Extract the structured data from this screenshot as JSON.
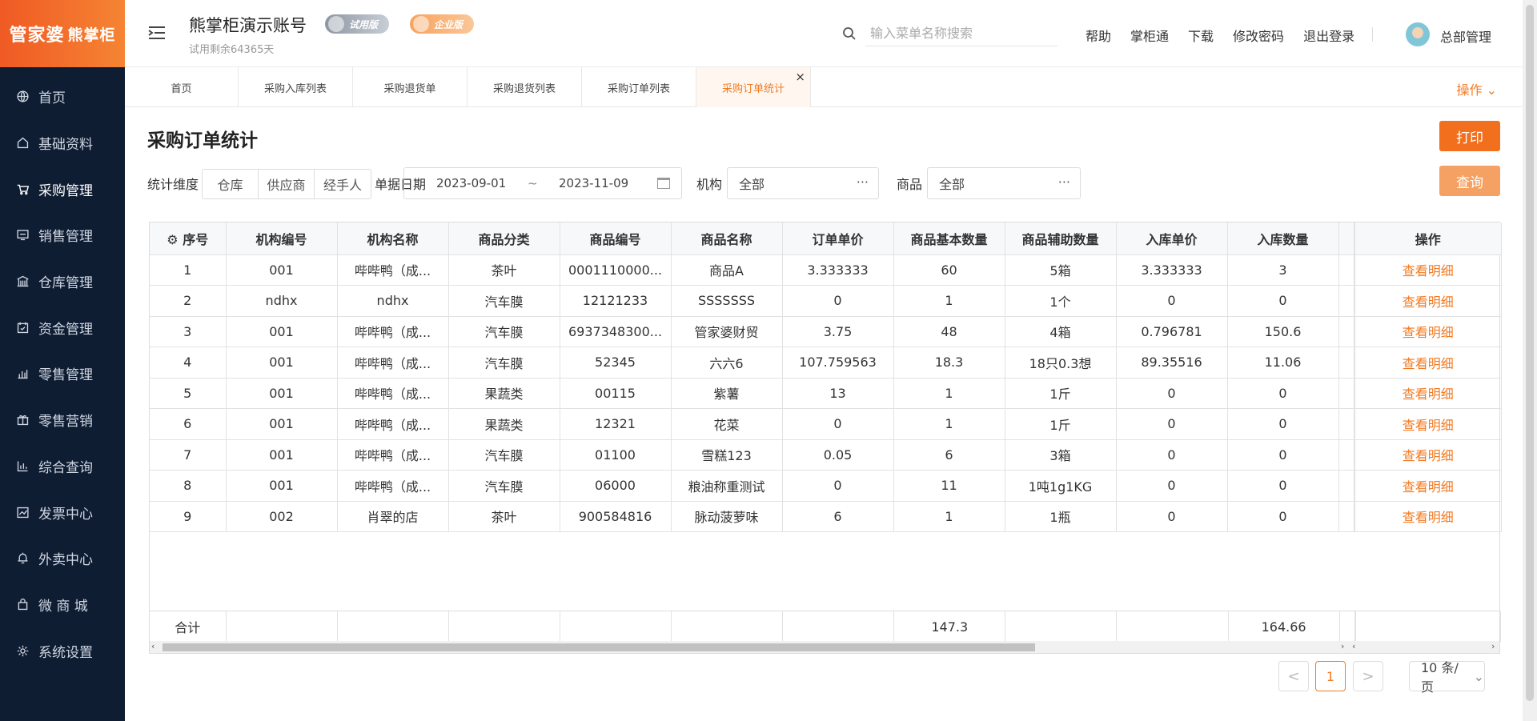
{
  "brand": {
    "logo_text": "管家婆",
    "logo_sub": "熊掌柜"
  },
  "sidebar": {
    "items": [
      {
        "label": "首页",
        "icon": "globe-icon"
      },
      {
        "label": "基础资料",
        "icon": "home-icon"
      },
      {
        "label": "采购管理",
        "icon": "cart-icon"
      },
      {
        "label": "销售管理",
        "icon": "monitor-icon"
      },
      {
        "label": "仓库管理",
        "icon": "warehouse-icon"
      },
      {
        "label": "资金管理",
        "icon": "calendar-icon"
      },
      {
        "label": "零售管理",
        "icon": "bar-chart-icon"
      },
      {
        "label": "零售营销",
        "icon": "gift-icon"
      },
      {
        "label": "综合查询",
        "icon": "column-chart-icon"
      },
      {
        "label": "发票中心",
        "icon": "line-chart-icon"
      },
      {
        "label": "外卖中心",
        "icon": "bell-icon"
      },
      {
        "label": "微 商 城",
        "icon": "bag-icon"
      },
      {
        "label": "系统设置",
        "icon": "gear-icon"
      }
    ]
  },
  "header": {
    "account_title": "熊掌柜演示账号",
    "trial_remaining": "试用剩余64365天",
    "badge_trial": "试用版",
    "badge_enterprise": "企业版",
    "search_placeholder": "输入菜单名称搜索",
    "links": [
      "帮助",
      "掌柜通",
      "下载",
      "修改密码",
      "退出登录"
    ],
    "user": "总部管理"
  },
  "tabs": {
    "items": [
      "首页",
      "采购入库列表",
      "采购退货单",
      "采购退货列表",
      "采购订单列表",
      "采购订单统计"
    ],
    "active": "采购订单统计",
    "close": "×",
    "ops_label": "操作"
  },
  "page": {
    "title": "采购订单统计",
    "print_label": "打印",
    "query_label": "查询"
  },
  "filters": {
    "dimension_label": "统计维度",
    "dimension_options": [
      "仓库",
      "供应商",
      "经手人"
    ],
    "date_label": "单据日期",
    "date_from": "2023-09-01",
    "date_sep": "~",
    "date_to": "2023-11-09",
    "org_label": "机构",
    "org_value": "全部",
    "goods_label": "商品",
    "goods_value": "全部",
    "more": "···"
  },
  "table": {
    "columns": [
      "序号",
      "机构编号",
      "机构名称",
      "商品分类",
      "商品编号",
      "商品名称",
      "订单单价",
      "商品基本数量",
      "商品辅助数量",
      "入库单价",
      "入库数量",
      "操作"
    ],
    "action_label": "查看明细",
    "rows": [
      [
        "1",
        "001",
        "哔哔鸭（成...",
        "茶叶",
        "0001110000...",
        "商品A",
        "3.333333",
        "60",
        "5箱",
        "3.333333",
        "3"
      ],
      [
        "2",
        "ndhx",
        "ndhx",
        "汽车膜",
        "12121233",
        "SSSSSSS",
        "0",
        "1",
        "1个",
        "0",
        "0"
      ],
      [
        "3",
        "001",
        "哔哔鸭（成...",
        "汽车膜",
        "6937348300...",
        "管家婆财贸",
        "3.75",
        "48",
        "4箱",
        "0.796781",
        "150.6"
      ],
      [
        "4",
        "001",
        "哔哔鸭（成...",
        "汽车膜",
        "52345",
        "六六6",
        "107.759563",
        "18.3",
        "18只0.3想",
        "89.35516",
        "11.06"
      ],
      [
        "5",
        "001",
        "哔哔鸭（成...",
        "果蔬类",
        "00115",
        "紫薯",
        "13",
        "1",
        "1斤",
        "0",
        "0"
      ],
      [
        "6",
        "001",
        "哔哔鸭（成...",
        "果蔬类",
        "12321",
        "花菜",
        "0",
        "1",
        "1斤",
        "0",
        "0"
      ],
      [
        "7",
        "001",
        "哔哔鸭（成...",
        "汽车膜",
        "01100",
        "雪糕123",
        "0.05",
        "6",
        "3箱",
        "0",
        "0"
      ],
      [
        "8",
        "001",
        "哔哔鸭（成...",
        "汽车膜",
        "06000",
        "粮油称重测试",
        "0",
        "11",
        "1吨1g1KG",
        "0",
        "0"
      ],
      [
        "9",
        "002",
        "肖翠的店",
        "茶叶",
        "900584816",
        "脉动菠萝味",
        "6",
        "1",
        "1瓶",
        "0",
        "0"
      ]
    ],
    "summary": {
      "label": "合计",
      "base_qty": "147.3",
      "in_qty": "164.66"
    }
  },
  "pagination": {
    "prev": "<",
    "current": "1",
    "next": ">",
    "page_size": "10 条/页"
  },
  "colors": {
    "accent": "#f37a22",
    "sidebar_bg": "#0f1d33",
    "print_btn": "#f26f1e",
    "query_btn": "#f6a164"
  }
}
